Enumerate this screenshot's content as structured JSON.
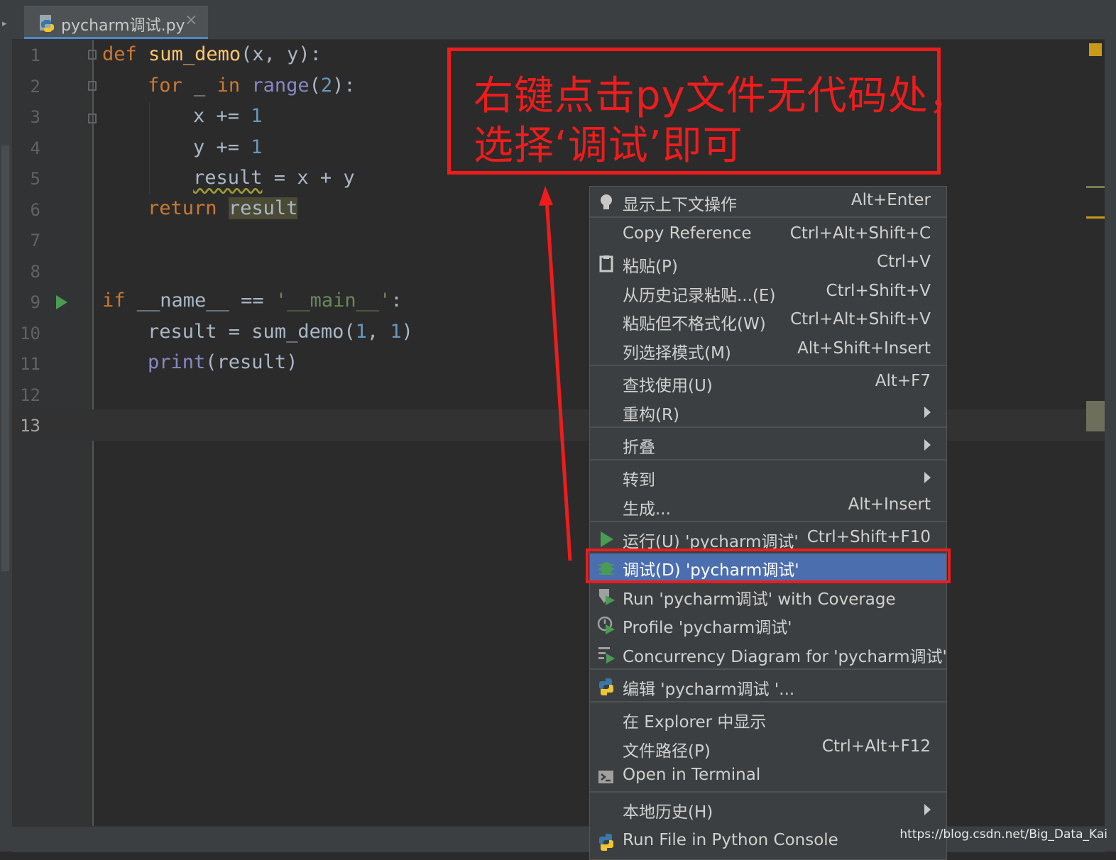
{
  "tab": {
    "filename": "pycharm调试.py",
    "close": "×"
  },
  "editor": {
    "line_numbers": [
      "1",
      "2",
      "3",
      "4",
      "5",
      "6",
      "7",
      "8",
      "9",
      "10",
      "11",
      "12",
      "13"
    ],
    "current_line": "13",
    "code": {
      "l1": [
        "def",
        "sum_demo",
        "(x, y):"
      ],
      "l2": [
        "for",
        " _ ",
        "in",
        " ",
        "range",
        "(",
        "2",
        "):"
      ],
      "l3": [
        "x += ",
        "1"
      ],
      "l4": [
        "y += ",
        "1"
      ],
      "l5": [
        "result",
        " = x + y"
      ],
      "l6": [
        "return",
        " ",
        "result"
      ],
      "l9": [
        "if",
        " __name__ == ",
        "'__main__'",
        ":"
      ],
      "l10": [
        "result = sum_demo(",
        "1",
        ", ",
        "1",
        ")"
      ],
      "l11": [
        "print",
        "(result)"
      ]
    }
  },
  "annotation": {
    "line1": "右键点击py文件无代码处，",
    "line2": "选择‘调试’即可"
  },
  "context_menu": {
    "items": [
      {
        "label": "显示上下文操作",
        "shortcut": "Alt+Enter",
        "icon": "lightbulb-icon"
      },
      {
        "label": "Copy Reference",
        "shortcut": "Ctrl+Alt+Shift+C"
      },
      {
        "label": "粘贴(P)",
        "shortcut": "Ctrl+V",
        "icon": "clipboard-icon"
      },
      {
        "label": "从历史记录粘贴...(E)",
        "shortcut": "Ctrl+Shift+V"
      },
      {
        "label": "粘贴但不格式化(W)",
        "shortcut": "Ctrl+Alt+Shift+V"
      },
      {
        "label": "列选择模式(M)",
        "shortcut": "Alt+Shift+Insert"
      },
      {
        "label": "查找使用(U)",
        "shortcut": "Alt+F7"
      },
      {
        "label": "重构(R)",
        "submenu": true
      },
      {
        "label": "折叠",
        "submenu": true
      },
      {
        "label": "转到",
        "submenu": true
      },
      {
        "label": "生成...",
        "shortcut": "Alt+Insert"
      },
      {
        "label": "运行(U) 'pycharm调试'",
        "shortcut": "Ctrl+Shift+F10",
        "icon": "run-icon"
      },
      {
        "label": "调试(D) 'pycharm调试'",
        "icon": "debug-bug-icon",
        "selected": true
      },
      {
        "label": "Run 'pycharm调试' with Coverage",
        "icon": "coverage-icon"
      },
      {
        "label": "Profile 'pycharm调试'",
        "icon": "profile-icon"
      },
      {
        "label": "Concurrency Diagram for 'pycharm调试'",
        "icon": "concurrency-icon"
      },
      {
        "label": "编辑 'pycharm调试 '...",
        "icon": "python-icon"
      },
      {
        "label": "在 Explorer 中显示"
      },
      {
        "label": "文件路径(P)",
        "shortcut": "Ctrl+Alt+F12"
      },
      {
        "label": "Open in Terminal",
        "icon": "terminal-icon"
      },
      {
        "label": "本地历史(H)",
        "submenu": true
      },
      {
        "label": "Run File in Python Console",
        "icon": "python-icon"
      }
    ]
  },
  "watermark": "https://blog.csdn.net/Big_Data_Kai",
  "colors": {
    "annotation_red": "#ee1c1c",
    "selection_blue": "#4b6eaf",
    "keyword": "#cc7832",
    "function": "#ffc66d",
    "number": "#6897bb",
    "string": "#6a8759",
    "run_green": "#499c54"
  }
}
